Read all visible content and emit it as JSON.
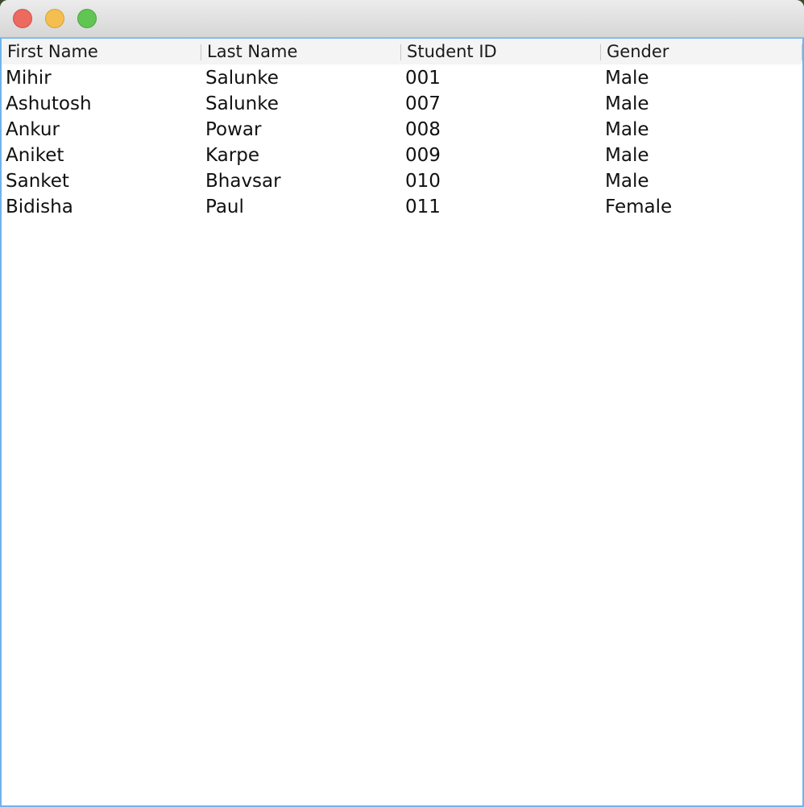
{
  "window": {
    "traffic_lights": [
      "close",
      "minimize",
      "zoom"
    ]
  },
  "table": {
    "columns": [
      "First Name",
      "Last Name",
      "Student ID",
      "Gender"
    ],
    "rows": [
      [
        "Mihir",
        "Salunke",
        "001",
        "Male"
      ],
      [
        "Ashutosh",
        "Salunke",
        "007",
        "Male"
      ],
      [
        "Ankur",
        "Powar",
        "008",
        "Male"
      ],
      [
        "Aniket",
        "Karpe",
        "009",
        "Male"
      ],
      [
        "Sanket",
        "Bhavsar",
        "010",
        "Male"
      ],
      [
        "Bidisha",
        "Paul",
        "011",
        "Female"
      ]
    ]
  }
}
